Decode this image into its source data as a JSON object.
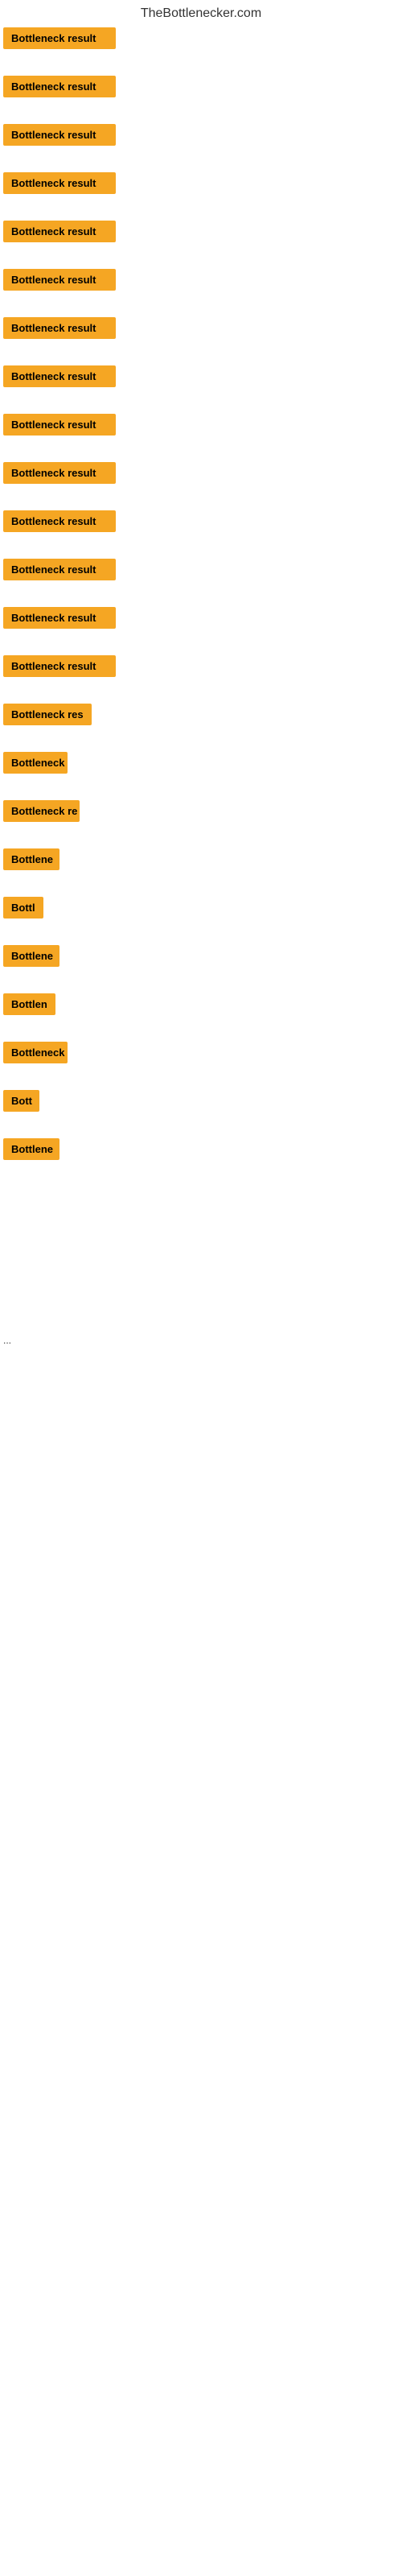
{
  "site": {
    "title": "TheBottlenecker.com"
  },
  "items": [
    {
      "id": 1,
      "label": "Bottleneck result",
      "width": 140
    },
    {
      "id": 2,
      "label": "Bottleneck result",
      "width": 140
    },
    {
      "id": 3,
      "label": "Bottleneck result",
      "width": 140
    },
    {
      "id": 4,
      "label": "Bottleneck result",
      "width": 140
    },
    {
      "id": 5,
      "label": "Bottleneck result",
      "width": 140
    },
    {
      "id": 6,
      "label": "Bottleneck result",
      "width": 140
    },
    {
      "id": 7,
      "label": "Bottleneck result",
      "width": 140
    },
    {
      "id": 8,
      "label": "Bottleneck result",
      "width": 140
    },
    {
      "id": 9,
      "label": "Bottleneck result",
      "width": 140
    },
    {
      "id": 10,
      "label": "Bottleneck result",
      "width": 140
    },
    {
      "id": 11,
      "label": "Bottleneck result",
      "width": 140
    },
    {
      "id": 12,
      "label": "Bottleneck result",
      "width": 140
    },
    {
      "id": 13,
      "label": "Bottleneck result",
      "width": 140
    },
    {
      "id": 14,
      "label": "Bottleneck result",
      "width": 140
    },
    {
      "id": 15,
      "label": "Bottleneck res",
      "width": 110
    },
    {
      "id": 16,
      "label": "Bottleneck",
      "width": 80
    },
    {
      "id": 17,
      "label": "Bottleneck re",
      "width": 95
    },
    {
      "id": 18,
      "label": "Bottlene",
      "width": 70
    },
    {
      "id": 19,
      "label": "Bottl",
      "width": 50
    },
    {
      "id": 20,
      "label": "Bottlene",
      "width": 70
    },
    {
      "id": 21,
      "label": "Bottlen",
      "width": 65
    },
    {
      "id": 22,
      "label": "Bottleneck",
      "width": 80
    },
    {
      "id": 23,
      "label": "Bott",
      "width": 45
    },
    {
      "id": 24,
      "label": "Bottlene",
      "width": 70
    }
  ],
  "ellipsis": "...",
  "colors": {
    "badge_bg": "#f5a623",
    "badge_text": "#000000",
    "title_text": "#333333"
  }
}
